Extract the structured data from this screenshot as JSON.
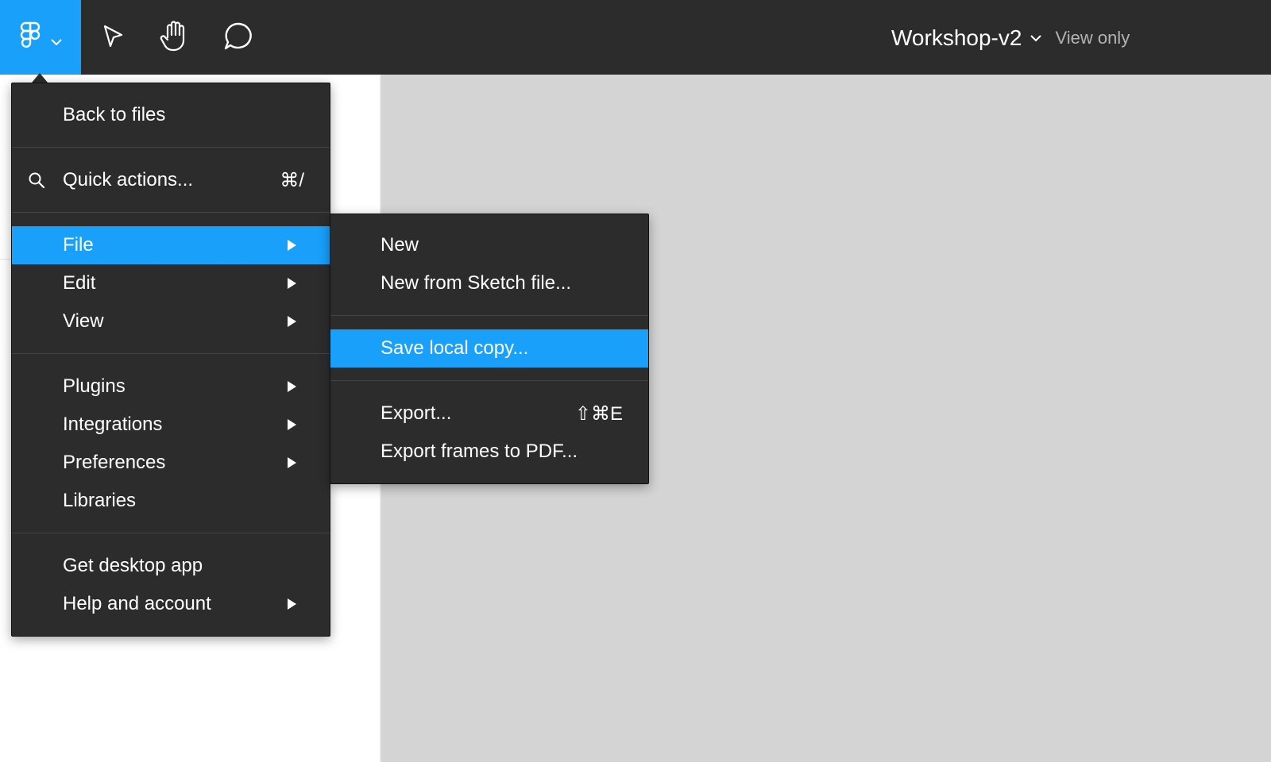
{
  "toolbar": {
    "tools": [
      {
        "icon": "move-cursor-icon"
      },
      {
        "icon": "hand-icon"
      },
      {
        "icon": "comment-icon"
      }
    ],
    "file_name": "Workshop-v2",
    "access_mode": "View only",
    "accent_color": "#18a0fb",
    "background_color": "#2c2c2c"
  },
  "main_menu": {
    "back": "Back to files",
    "quick_actions": {
      "label": "Quick actions...",
      "shortcut": "⌘/"
    },
    "file": "File",
    "edit": "Edit",
    "view": "View",
    "plugins": "Plugins",
    "integrations": "Integrations",
    "preferences": "Preferences",
    "libraries": "Libraries",
    "desktop_app": "Get desktop app",
    "help": "Help and account"
  },
  "file_menu": {
    "new": "New",
    "new_from_sketch": "New from Sketch file...",
    "save_local": "Save local copy...",
    "export": {
      "label": "Export...",
      "shortcut": "⇧⌘E"
    },
    "export_pdf": "Export frames to PDF..."
  }
}
